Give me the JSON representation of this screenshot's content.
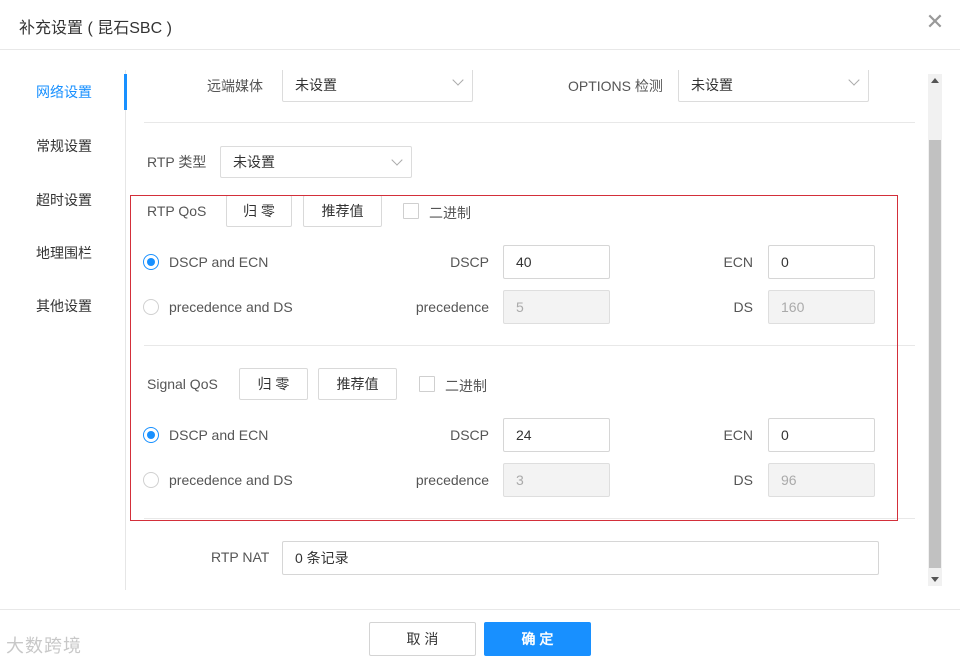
{
  "dialog": {
    "title": "补充设置 ( 昆石SBC )",
    "close_icon": "close-icon"
  },
  "nav": {
    "items": [
      {
        "label": "网络设置",
        "active": true
      },
      {
        "label": "常规设置",
        "active": false
      },
      {
        "label": "超时设置",
        "active": false
      },
      {
        "label": "地理围栏",
        "active": false
      },
      {
        "label": "其他设置",
        "active": false
      }
    ]
  },
  "top_row": {
    "remote_media_label": "远端媒体",
    "remote_media_value": "未设置",
    "options_label": "OPTIONS 检测",
    "options_value": "未设置"
  },
  "rtp_type": {
    "label": "RTP 类型",
    "value": "未设置"
  },
  "rtp_qos": {
    "label": "RTP QoS",
    "reset_button": "归 零",
    "recommended_button": "推荐值",
    "binary_label": "二进制",
    "option1_label": "DSCP and ECN",
    "option2_label": "precedence and DS",
    "dscp_label": "DSCP",
    "dscp_value": "40",
    "ecn_label": "ECN",
    "ecn_value": "0",
    "precedence_label": "precedence",
    "precedence_value": "5",
    "ds_label": "DS",
    "ds_value": "160"
  },
  "signal_qos": {
    "label": "Signal QoS",
    "reset_button": "归 零",
    "recommended_button": "推荐值",
    "binary_label": "二进制",
    "option1_label": "DSCP and ECN",
    "option2_label": "precedence and DS",
    "dscp_label": "DSCP",
    "dscp_value": "24",
    "ecn_label": "ECN",
    "ecn_value": "0",
    "precedence_label": "precedence",
    "precedence_value": "3",
    "ds_label": "DS",
    "ds_value": "96"
  },
  "rtp_nat": {
    "label": "RTP NAT",
    "value": "0 条记录"
  },
  "footer": {
    "cancel_label": "取 消",
    "ok_label": "确 定"
  },
  "watermark": "大数跨境",
  "colors": {
    "accent": "#1890ff",
    "highlight_border": "#d32f3a"
  }
}
